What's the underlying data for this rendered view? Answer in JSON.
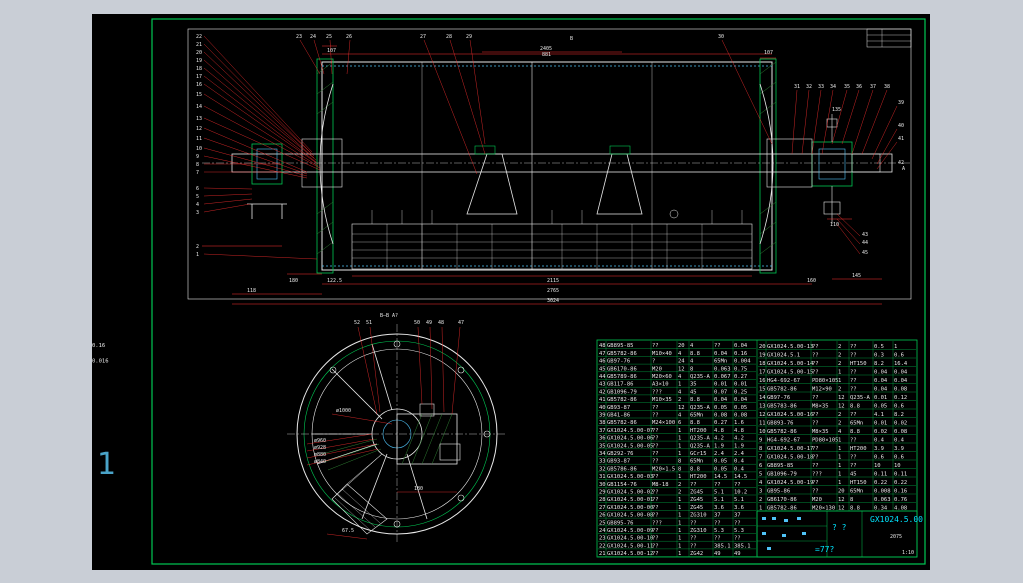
{
  "sheet": {
    "margin_mark": "1",
    "title_block": {
      "drawing_no": "GX1024.5.00",
      "scale": "1:10",
      "marks": "? ?",
      "weight": "=77?",
      "sheet_ref": "2075"
    }
  },
  "main_view": {
    "section_mark": "B",
    "dims": {
      "top_span": "2405",
      "top_inner": "881",
      "right_top": "107",
      "left_top": "107",
      "overall": "3024",
      "mid": "2765",
      "lower": "2115",
      "left_a": "118",
      "left_b": "180",
      "left_c": "122.5",
      "right_a": "160",
      "right_b": "145",
      "shaft_dim": "135",
      "bot_dim": "110"
    },
    "balloons_left": [
      "22",
      "21",
      "20",
      "19",
      "18",
      "17",
      "16",
      "15",
      "14",
      "13",
      "12",
      "11",
      "10",
      "9",
      "8",
      "7",
      "6",
      "5",
      "4",
      "3",
      "2",
      "1"
    ],
    "balloons_top": [
      "23",
      "24",
      "25",
      "26",
      "27",
      "28",
      "29",
      "30"
    ],
    "balloons_right": [
      "31",
      "32",
      "33",
      "34",
      "35",
      "36",
      "37",
      "38",
      "39",
      "40",
      "41",
      "42",
      "43",
      "44",
      "45"
    ],
    "view_mark": "A"
  },
  "section_view": {
    "title": "B—B  A?",
    "balloons": [
      "52",
      "51",
      "50",
      "49",
      "48",
      "47"
    ],
    "dims": [
      "ø1000",
      "ø960",
      "ø928",
      "ø880",
      "ø840",
      "180",
      "67.5"
    ]
  },
  "parts_table": {
    "left": [
      [
        "48",
        "GB895-85",
        "??",
        "20",
        "4",
        "??",
        "0.04",
        "0.16"
      ],
      [
        "47",
        "GB5782-86",
        "M10×40",
        "4",
        "8.8",
        "0.04",
        "0.16"
      ],
      [
        "46",
        "GB97-76",
        "?",
        "24",
        "4",
        "65Mn",
        "0.004",
        "0.016"
      ],
      [
        "45",
        "GB6170-86",
        "M20",
        "12",
        "8",
        "0.063",
        "0.75"
      ],
      [
        "44",
        "GB5789-86",
        "M20×60",
        "4",
        "Q235-A",
        "0.067",
        "0.27"
      ],
      [
        "43",
        "GB117-86",
        "A3×10",
        "1",
        "35",
        "0.01",
        "0.01"
      ],
      [
        "42",
        "GB1096-79",
        "???",
        "4",
        "45",
        "0.07",
        "0.25"
      ],
      [
        "41",
        "GB5782-86",
        "M10×35",
        "2",
        "8.8",
        "0.04",
        "0.04"
      ],
      [
        "40",
        "GB93-87",
        "??",
        "12",
        "Q235-A",
        "0.05",
        "0.05"
      ],
      [
        "39",
        "GB41-86",
        "??",
        "4",
        "65Mn",
        "0.08",
        "0.08"
      ],
      [
        "38",
        "GB5782-86",
        "M24×100",
        "6",
        "8.8",
        "0.27",
        "1.6"
      ],
      [
        "37",
        "GX1024.5.00-07",
        "??",
        "1",
        "HT200",
        "4.8",
        "4.8"
      ],
      [
        "36",
        "GX1024.5.00-06",
        "??",
        "1",
        "Q235-A",
        "4.2",
        "4.2"
      ],
      [
        "35",
        "GX1024.5.00-05",
        "??",
        "1",
        "Q235-A",
        "1.9",
        "1.9"
      ],
      [
        "34",
        "GB292-76",
        "??",
        "1",
        "GCr15",
        "2.4",
        "2.4"
      ],
      [
        "33",
        "GB93-87",
        "??",
        "8",
        "65Mn",
        "0.05",
        "0.4"
      ],
      [
        "32",
        "GB5786-86",
        "M20×1.5",
        "8",
        "8.8",
        "0.05",
        "0.4"
      ],
      [
        "31",
        "GX1024.5.00-03",
        "??",
        "1",
        "HT200",
        "14.5",
        "14.5"
      ],
      [
        "30",
        "GB1154-76",
        "M8-18",
        "2",
        "??",
        "??",
        "??"
      ],
      [
        "29",
        "GX1024.5.00-02",
        "??",
        "2",
        "ZG45",
        "5.1",
        "10.2"
      ],
      [
        "28",
        "GX1024.5.00-01",
        "??",
        "1",
        "ZG45",
        "5.1",
        "5.1"
      ],
      [
        "27",
        "GX1024.5.00-00",
        "??",
        "1",
        "ZG45",
        "3.6",
        "3.6"
      ],
      [
        "26",
        "GX1024.5.00-08",
        "??",
        "1",
        "ZG310",
        "37",
        "37"
      ],
      [
        "25",
        "GB895-76",
        "???",
        "1",
        "??",
        "??",
        "??"
      ],
      [
        "24",
        "GX1024.5.00-09",
        "??",
        "1",
        "ZG310",
        "5.3",
        "5.3"
      ],
      [
        "23",
        "GX1024.5.00-10",
        "??",
        "1",
        "??",
        "??",
        "??"
      ],
      [
        "22",
        "GX1024.5.00-11",
        "??",
        "1",
        "??",
        "385.1",
        "385.1"
      ],
      [
        "21",
        "GX1024.5.00-12",
        "??",
        "1",
        "ZG42",
        "49",
        "49"
      ]
    ],
    "right": [
      [
        "20",
        "GX1024.5.00-13",
        "??",
        "2",
        "??",
        "0.5",
        "1"
      ],
      [
        "19",
        "GX1024.5.1",
        "??",
        "2",
        "??",
        "0.3",
        "0.6"
      ],
      [
        "18",
        "GX1024.5.00-14",
        "??",
        "2",
        "HT150",
        "8.2",
        "16.4"
      ],
      [
        "17",
        "GX1024.5.00-15",
        "??",
        "1",
        "??",
        "0.04",
        "0.04"
      ],
      [
        "16",
        "HG4-692-67",
        "PD80×105",
        "1",
        "??",
        "0.04",
        "0.04"
      ],
      [
        "15",
        "GB5782-86",
        "M12×90",
        "2",
        "??",
        "0.04",
        "0.08"
      ],
      [
        "14",
        "GB97-76",
        "??",
        "12",
        "Q235-A",
        "0.01",
        "0.12"
      ],
      [
        "13",
        "GB5783-86",
        "M8×35",
        "12",
        "8.8",
        "0.05",
        "0.6"
      ],
      [
        "12",
        "GX1024.5.00-16",
        "??",
        "2",
        "??",
        "4.1",
        "8.2"
      ],
      [
        "11",
        "GB893-76",
        "??",
        "2",
        "65Mn",
        "0.01",
        "0.02"
      ],
      [
        "10",
        "GB5782-86",
        "M8×35",
        "4",
        "8.8",
        "0.02",
        "0.08"
      ],
      [
        "9",
        "HG4-692-67",
        "PD80×105",
        "1",
        "??",
        "0.4",
        "0.4"
      ],
      [
        "8",
        "GX1024.5.00-17",
        "??",
        "1",
        "HT200",
        "3.9",
        "3.9"
      ],
      [
        "7",
        "GX1024.5.00-18",
        "??",
        "1",
        "??",
        "0.6",
        "0.6"
      ],
      [
        "6",
        "GB895-85",
        "??",
        "1",
        "??",
        "10",
        "10"
      ],
      [
        "5",
        "GB1096-79",
        "???",
        "1",
        "45",
        "0.11",
        "0.11"
      ],
      [
        "4",
        "GX1024.5.00-19",
        "??",
        "1",
        "HT150",
        "0.22",
        "0.22"
      ],
      [
        "3",
        "GB95-86",
        "??",
        "20",
        "65Mn",
        "0.008",
        "0.16"
      ],
      [
        "2",
        "GB6170-86",
        "M20",
        "12",
        "8",
        "0.063",
        "0.76"
      ],
      [
        "1",
        "GB5782-86",
        "M20×130",
        "12",
        "8.8",
        "0.34",
        "4.08"
      ]
    ]
  },
  "colors": {
    "frame": "#00c853",
    "lines": "#e8e8e8",
    "hatch": "#2e7d32",
    "dim": "#ff3030",
    "accent": "#00e5ff"
  }
}
